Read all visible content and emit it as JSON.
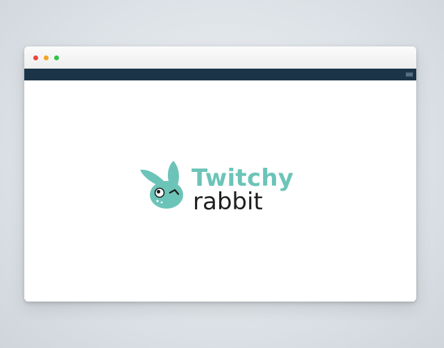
{
  "window": {
    "controls": [
      "close",
      "minimize",
      "maximize"
    ],
    "colors": {
      "close": "#e9473b",
      "minimize": "#f2a425",
      "maximize": "#34c34a",
      "nav_bar": "#1b3448"
    }
  },
  "nav": {
    "menu_icon": "hamburger-icon"
  },
  "logo": {
    "line1": "Twitchy",
    "line2": "rabbit",
    "mark_icon": "rabbit-head-icon",
    "colors": {
      "accent": "#6cc4b8",
      "text": "#1e1e1e"
    }
  }
}
